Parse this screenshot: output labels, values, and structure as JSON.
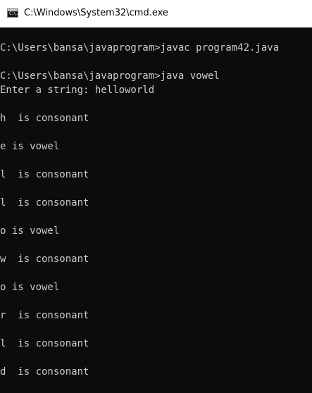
{
  "window": {
    "title": "C:\\Windows\\System32\\cmd.exe",
    "icon": "console-icon",
    "icon_glyph": "C:\\."
  },
  "colors": {
    "background": "#0c0c0c",
    "text": "#cccccc",
    "titlebar": "#ffffff"
  },
  "console": {
    "lines": [
      "C:\\Users\\bansa\\javaprogram>javac program42.java",
      "C:\\Users\\bansa\\javaprogram>java vowel",
      "Enter a string: helloworld",
      "h  is consonant",
      "e is vowel",
      "l  is consonant",
      "l  is consonant",
      "o is vowel",
      "w  is consonant",
      "o is vowel",
      "r  is consonant",
      "l  is consonant",
      "d  is consonant"
    ]
  }
}
